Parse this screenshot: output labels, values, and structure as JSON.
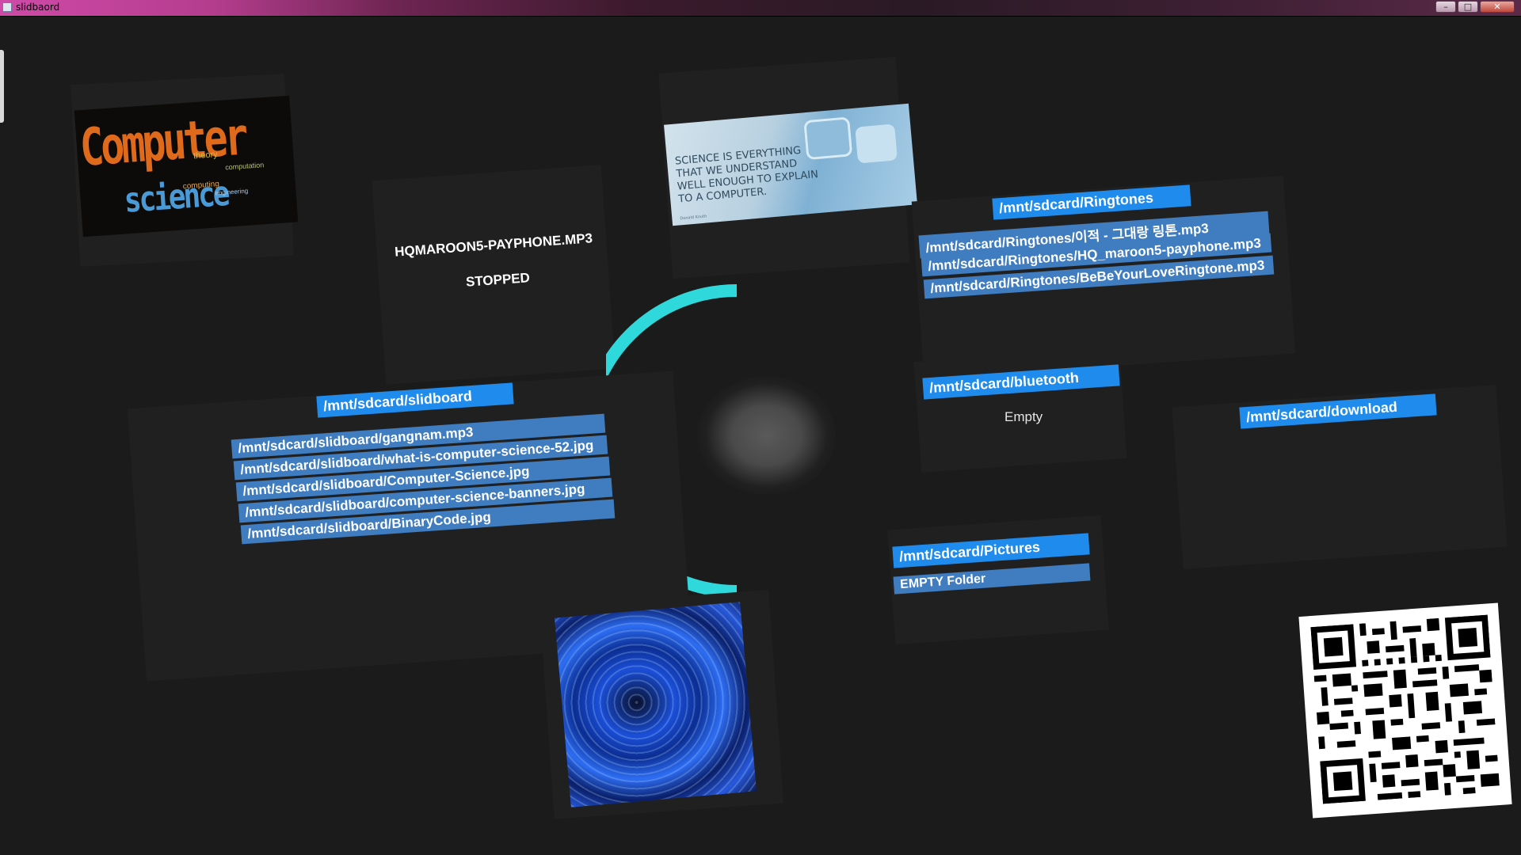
{
  "window": {
    "title": "slidbaord",
    "controls": {
      "minimize": "–",
      "maximize": "□",
      "close": "✕"
    }
  },
  "player": {
    "track": "HQMAROON5-PAYPHONE.MP3",
    "status": "STOPPED"
  },
  "images": {
    "computer_science": {
      "title_word": "Computer",
      "sub_word": "science",
      "extra_words": [
        "theory",
        "computing",
        "computation",
        "engineering"
      ]
    },
    "quote": {
      "lines": [
        "SCIENCE IS EVERYTHING",
        "THAT WE UNDERSTAND",
        "WELL ENOUGH TO EXPLAIN",
        "TO A COMPUTER."
      ],
      "author": "Donald Knuth"
    }
  },
  "folders": {
    "slidboard": {
      "path": "/mnt/sdcard/slidboard",
      "files": [
        "/mnt/sdcard/slidboard/gangnam.mp3",
        "/mnt/sdcard/slidboard/what-is-computer-science-52.jpg",
        "/mnt/sdcard/slidboard/Computer-Science.jpg",
        "/mnt/sdcard/slidboard/computer-science-banners.jpg",
        "/mnt/sdcard/slidboard/BinaryCode.jpg"
      ]
    },
    "ringtones": {
      "path": "/mnt/sdcard/Ringtones",
      "files": [
        "/mnt/sdcard/Ringtones/이적 - 그대랑 링톤.mp3",
        "/mnt/sdcard/Ringtones/HQ_maroon5-payphone.mp3",
        "/mnt/sdcard/Ringtones/BeBeYourLoveRingtone.mp3"
      ]
    },
    "bluetooth": {
      "path": "/mnt/sdcard/bluetooth",
      "empty_text": "Empty"
    },
    "download": {
      "path": "/mnt/sdcard/download"
    },
    "pictures": {
      "path": "/mnt/sdcard/Pictures",
      "empty_text": "EMPTY Folder"
    }
  },
  "colors": {
    "background": "#1b1b1b",
    "folder_tab": "#1e8bed",
    "file_row": "#3f7cc0",
    "ring": "#2fd8da"
  },
  "icons": [
    "app-icon",
    "progress-ring",
    "center-orb",
    "qr-code"
  ]
}
